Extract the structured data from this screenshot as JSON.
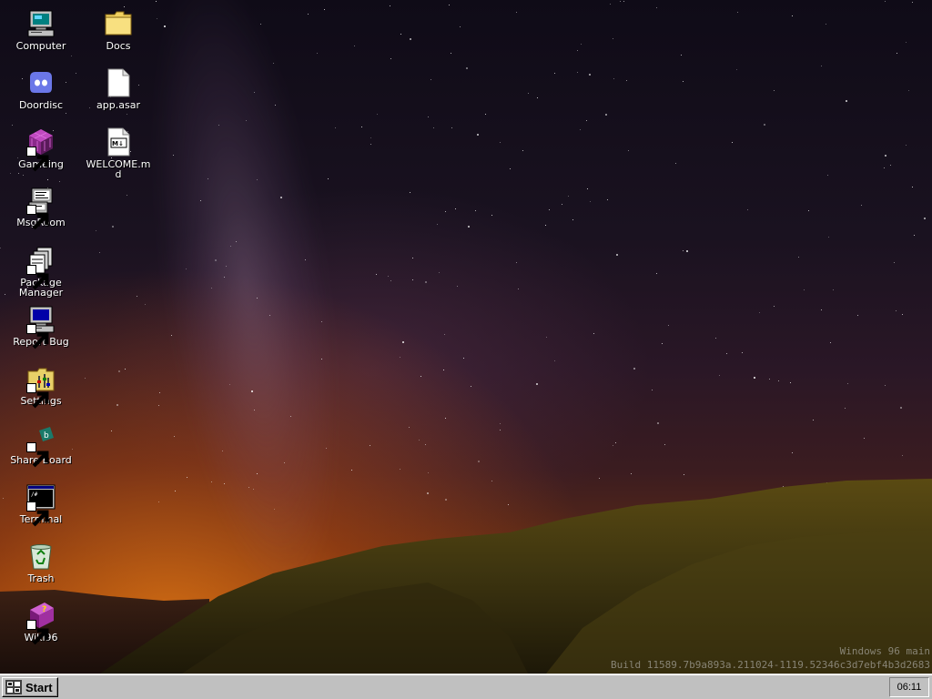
{
  "desktop": {
    "icons": [
      {
        "label": "Computer",
        "icon": "computer-icon"
      },
      {
        "label": "Doordisc",
        "icon": "chat-app-icon"
      },
      {
        "label": "Gameing",
        "icon": "game-cube-icon"
      },
      {
        "label": "MsgRoom",
        "icon": "message-room-icon"
      },
      {
        "label": "Package Manager",
        "icon": "package-manager-icon"
      },
      {
        "label": "Report Bug",
        "icon": "report-bug-icon"
      },
      {
        "label": "Settings",
        "icon": "settings-folder-icon"
      },
      {
        "label": "Share Board",
        "icon": "share-board-icon"
      },
      {
        "label": "Terminal",
        "icon": "terminal-icon"
      },
      {
        "label": "Trash",
        "icon": "recycle-bin-icon"
      },
      {
        "label": "Wiki96",
        "icon": "help-book-icon"
      },
      {
        "label": "Docs",
        "icon": "folder-icon"
      },
      {
        "label": "app.asar",
        "icon": "file-icon"
      },
      {
        "label": "WELCOME.md",
        "icon": "markdown-file-icon"
      }
    ]
  },
  "watermark": {
    "line1": "Windows 96 main",
    "line2": "Build 11589.7b9a893a.211024-1119.52346c3d7ebf4b3d2683"
  },
  "taskbar": {
    "start_label": "Start",
    "clock": "06:11"
  },
  "colors": {
    "taskbar_bg": "#c0c0c0",
    "desktop_text": "#ffffff"
  }
}
